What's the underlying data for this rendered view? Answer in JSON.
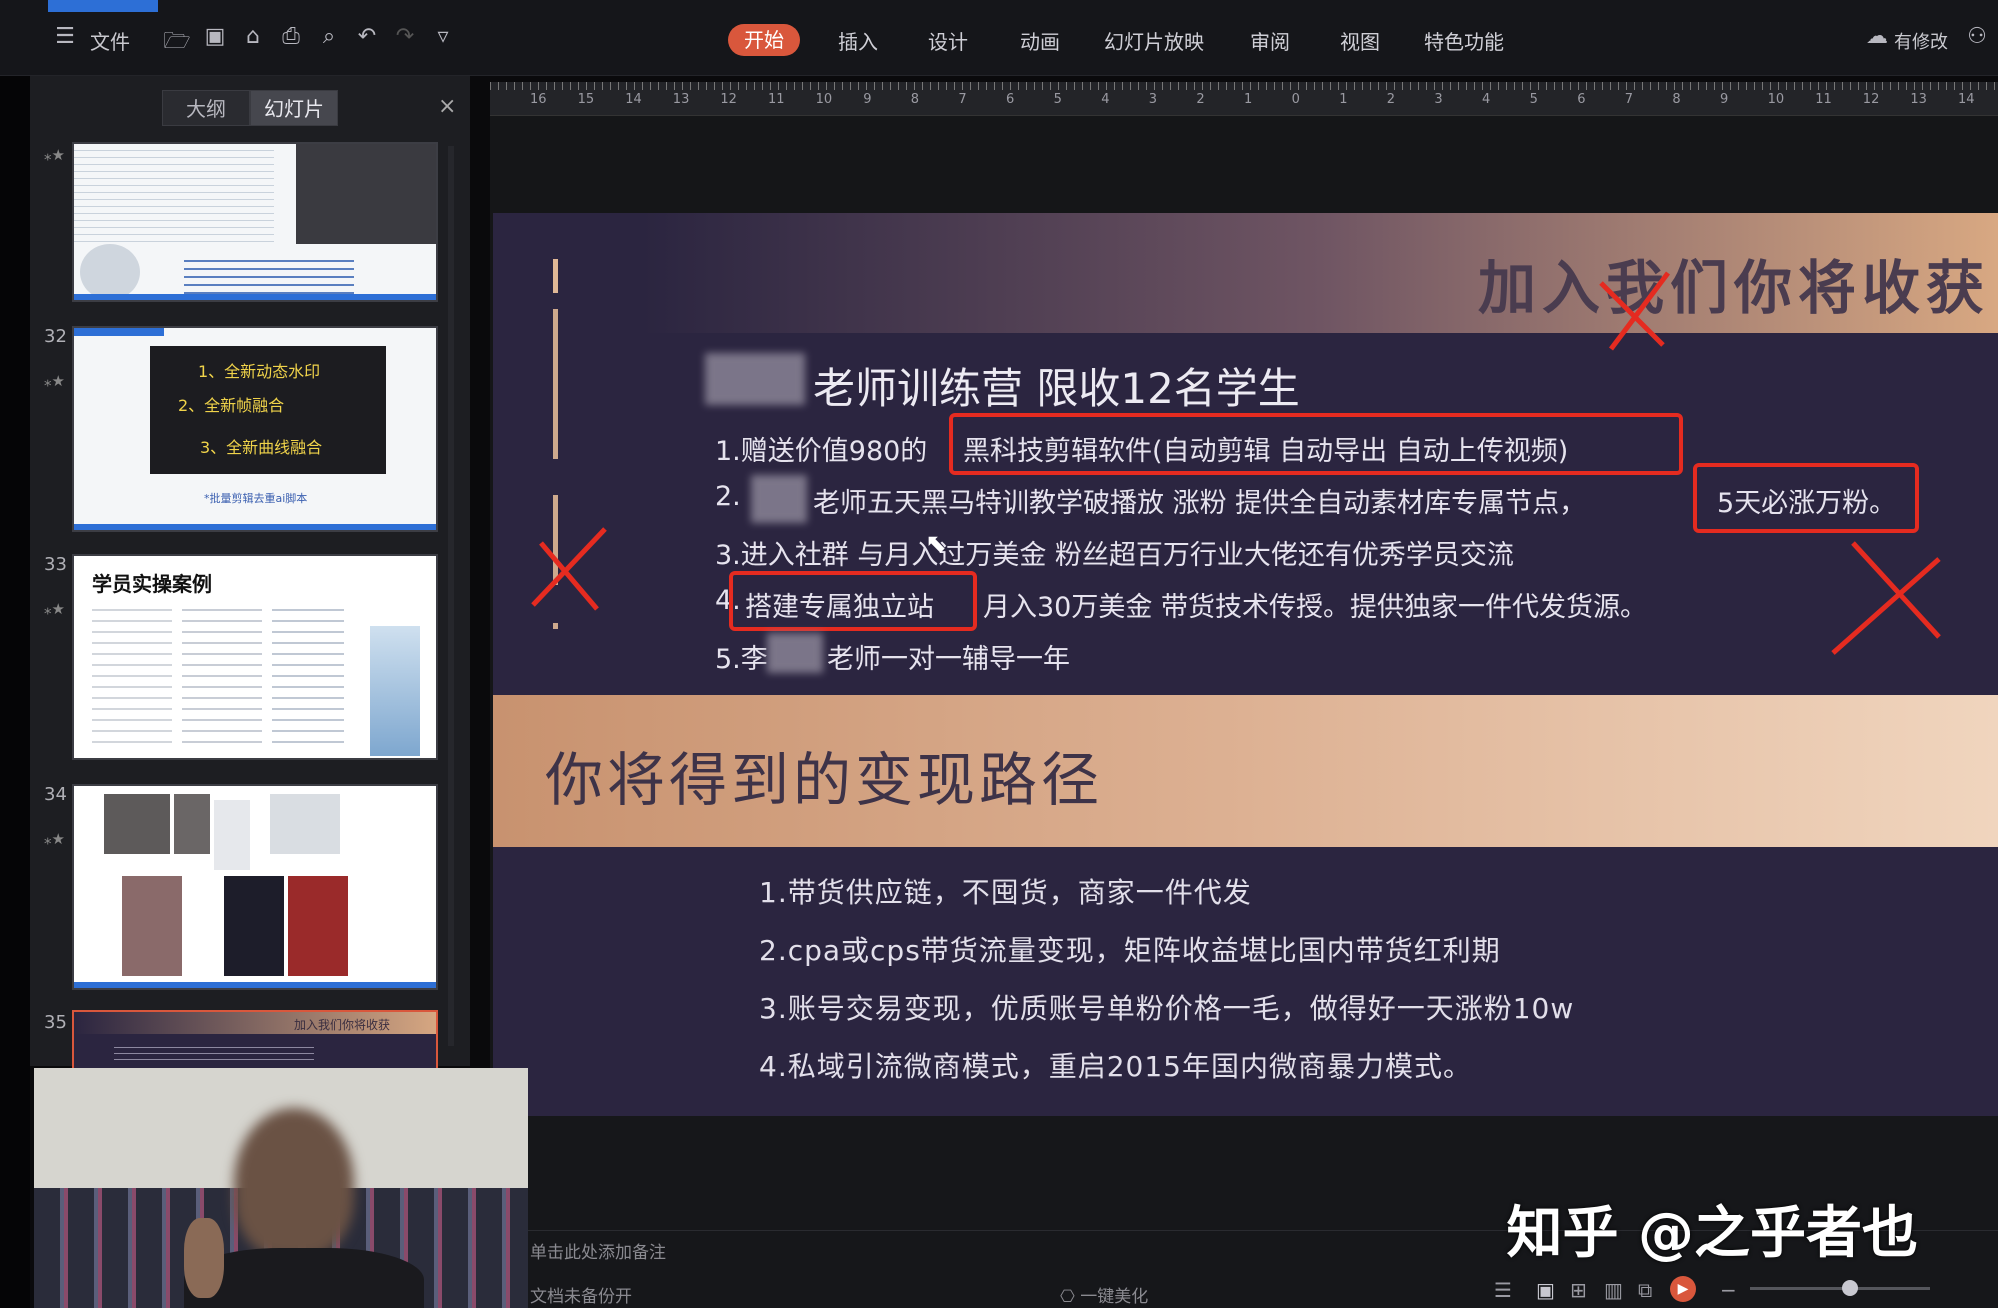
{
  "toolbar": {
    "menu_label": "文件",
    "tabs": [
      "开始",
      "插入",
      "设计",
      "动画",
      "幻灯片放映",
      "审阅",
      "视图",
      "特色功能"
    ],
    "modified_label": "有修改"
  },
  "left_panel": {
    "view_outline": "大纲",
    "view_slides": "幻灯片",
    "slide_numbers": [
      "32",
      "33",
      "34",
      "35"
    ],
    "thumb32": {
      "line1": "1、全新动态水印",
      "line2": "2、全新帧融合",
      "line3": "3、全新曲线融合",
      "caption": "*批量剪辑去重ai脚本"
    },
    "thumb33_title": "学员实操案例",
    "thumb35_title": "加入我们你将收获"
  },
  "ruler": {
    "ticks": [
      "16",
      "15",
      "14",
      "13",
      "12",
      "11",
      "10",
      "9",
      "8",
      "7",
      "6",
      "5",
      "4",
      "3",
      "2",
      "1",
      "0",
      "1",
      "2",
      "3",
      "4",
      "5",
      "6",
      "7",
      "8",
      "9",
      "10",
      "11",
      "12",
      "13",
      "14"
    ]
  },
  "slide": {
    "title": "加入我们你将收获",
    "subheading": "老师训练营 限收12名学生",
    "item1_prefix": "1.赠送价值980的",
    "item1_box": "黑科技剪辑软件(自动剪辑 自动导出 自动上传视频)",
    "item2_prefix": "2.",
    "item2_text": "老师五天黑马特训教学破播放 涨粉 提供全自动素材库专属节点，",
    "item2_box": "5天必涨万粉。",
    "item3": "3.进入社群 与月入过万美金 粉丝超百万行业大佬还有优秀学员交流",
    "item4_prefix": "4.",
    "item4_box": "搭建专属独立站",
    "item4_text": "月入30万美金 带货技术传授。提供独家一件代发货源。",
    "item5_prefix": "5.李",
    "item5_text": "老师一对一辅导一年",
    "band_title": "你将得到的变现路径",
    "paths": [
      "1.带货供应链，不囤货，商家一件代发",
      "2.cpa或cps带货流量变现，矩阵收益堪比国内带货红利期",
      "3.账号交易变现，优质账号单粉价格一毛，做得好一天涨粉10w",
      "4.私域引流微商模式，重启2015年国内微商暴力模式。"
    ]
  },
  "bottom": {
    "notes": "单击此处添加备注",
    "status_left": "文档未备份开",
    "beautify": "一键美化"
  },
  "watermark": "知乎 @之乎者也",
  "colors": {
    "accent_orange": "#d9573c",
    "annotation_red": "#e52b20",
    "slide_bg": "#2b2540",
    "band_gold": "#ddb193"
  }
}
